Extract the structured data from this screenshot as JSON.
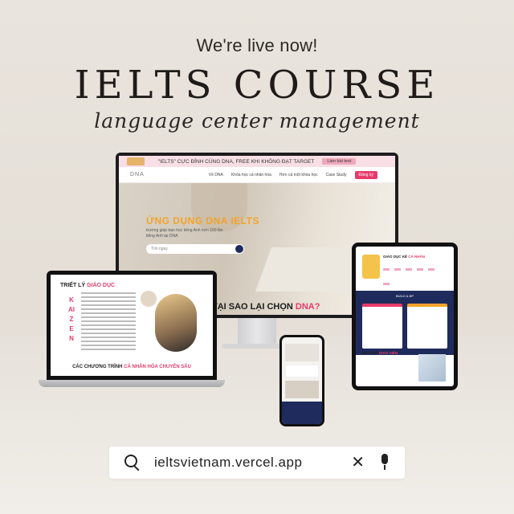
{
  "headline": "We're live now!",
  "title": "IELTS COURSE",
  "subtitle": "language center management",
  "monitor": {
    "banner_text": "\"IELTS\" CỰC ĐỈNH CÙNG DNA, FREE KHI KHÔNG ĐẠT TARGET",
    "banner_cta": "Làm bài test",
    "brand": "DNA",
    "nav": [
      "Về DNA",
      "Khóa học cá nhân hóa",
      "Hơn cả một khóa học",
      "Case Study"
    ],
    "register": "Đăng ký",
    "hero_title": "ỨNG DỤNG DNA IELTS",
    "hero_sub": "trường giúp bạn học tiếng Anh hơn 100 lần tiếng Anh tại DNA",
    "hero_search": "Tìm ngay",
    "why_prefix": "TẠI SAO LẠI CHỌN ",
    "why_highlight": "DNA?"
  },
  "laptop": {
    "title_prefix": "TRIẾT LÝ ",
    "title_highlight": "GIÁO DỤC",
    "kaizen": "KAIZEN",
    "bottom_prefix": "CÁC CHƯƠNG TRÌNH ",
    "bottom_highlight": "CÁ NHÂN HÓA CHUYÊN SÂU"
  },
  "tablet": {
    "top_prefix": "GIÁO DỤC KẾ ",
    "top_highlight": "CÁ NHÂN",
    "band_label": "BUILD & BP",
    "section_prefix": "HỘI NHỮ ",
    "section_highlight": "GIÁO VIÊN"
  },
  "search": {
    "query": "ieltsvietnam.vercel.app",
    "close_glyph": "✕"
  },
  "colors": {
    "accent_pink": "#e63b6b",
    "accent_orange": "#f3a32a",
    "navy": "#1f2b5c"
  }
}
